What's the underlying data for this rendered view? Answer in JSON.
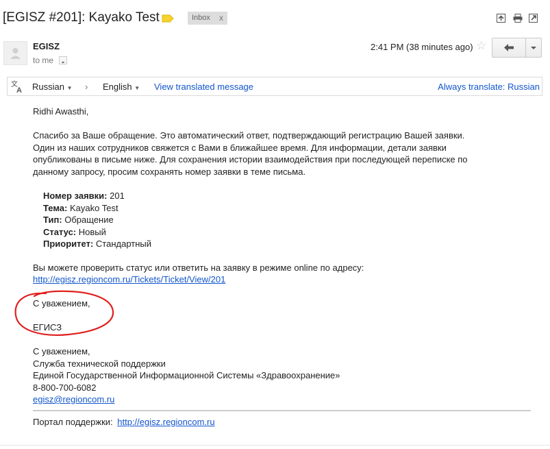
{
  "subject": "[EGISZ #201]: Kayako Test",
  "inbox_chip": {
    "label": "Inbox",
    "close": "x"
  },
  "colors": {
    "label_tag": "#f6d32d",
    "link": "#1155cc",
    "annotation": "#e02020"
  },
  "top_icons": [
    "new-window-icon",
    "print-icon",
    "popout-icon"
  ],
  "header": {
    "sender": "EGISZ",
    "to": "to me",
    "time": "2:41 PM (38 minutes ago)"
  },
  "translate_bar": {
    "source_lang": "Russian",
    "target_lang": "English",
    "view_link": "View translated message",
    "always": "Always translate: Russian"
  },
  "body": {
    "greeting": "Ridhi Awasthi,",
    "para1": [
      "Спасибо за Ваше обращение. Это автоматический ответ, подтверждающий регистрацию Вашей заявки.",
      "Один из наших сотрудников свяжется с Вами в ближайшее время. Для информации, детали заявки",
      "опубликованы в письме ниже. Для сохранения истории взаимодействия при последующей переписке по",
      "данному запросу, просим сохранять номер заявки в теме письма."
    ],
    "fields": [
      {
        "label": "Номер заявки:",
        "value": "201"
      },
      {
        "label": "Тема:",
        "value": "Kayako Test"
      },
      {
        "label": "Тип:",
        "value": "Обращение"
      },
      {
        "label": "Статус:",
        "value": "Новый"
      },
      {
        "label": "Приоритет:",
        "value": "Стандартный"
      }
    ],
    "check_line": "Вы можете проверить статус или ответить на заявку в режиме online по адресу:",
    "ticket_link": "http://egisz.regioncom.ru/Tickets/Ticket/View/201",
    "regards1": "С уважением,",
    "egisz": "ЕГИСЗ",
    "sig": [
      "С уважением,",
      "Служба технической поддержки",
      "Единой Государственной Информационной Системы «Здравоохранение»",
      "8-800-700-6082"
    ],
    "email": "egisz@regioncom.ru",
    "portal_label": "Портал поддержки:",
    "portal_link": "http://egisz.regioncom.ru"
  }
}
